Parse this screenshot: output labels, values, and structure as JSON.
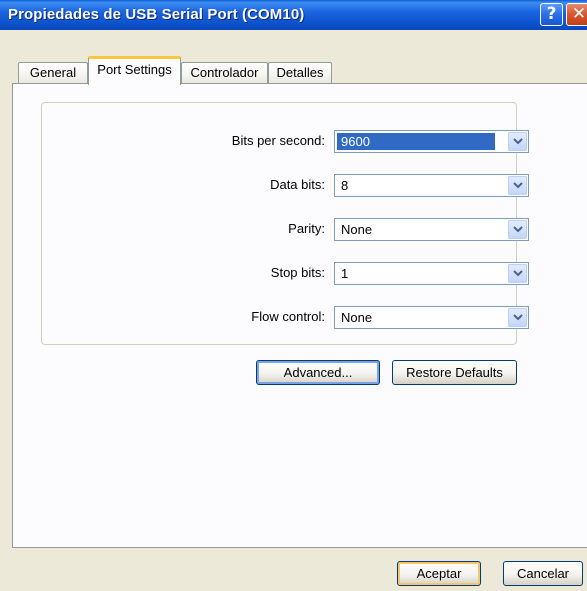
{
  "window": {
    "title": "Propiedades de USB Serial Port (COM10)",
    "help_glyph": "?",
    "close_glyph": "✕"
  },
  "tabs": [
    {
      "label": "General",
      "active": false
    },
    {
      "label": "Port Settings",
      "active": true
    },
    {
      "label": "Controlador",
      "active": false
    },
    {
      "label": "Detalles",
      "active": false
    }
  ],
  "settings": {
    "bits_per_second": {
      "label": "Bits per second:",
      "value": "9600"
    },
    "data_bits": {
      "label": "Data bits:",
      "value": "8"
    },
    "parity": {
      "label": "Parity:",
      "value": "None"
    },
    "stop_bits": {
      "label": "Stop bits:",
      "value": "1"
    },
    "flow_control": {
      "label": "Flow control:",
      "value": "None"
    }
  },
  "buttons": {
    "advanced": "Advanced...",
    "restore_defaults": "Restore Defaults",
    "accept": "Aceptar",
    "cancel": "Cancelar"
  },
  "colors": {
    "titlebar": "#0b4fc8",
    "selection": "#316ac5",
    "active_tab_accent": "#ffc83c"
  }
}
